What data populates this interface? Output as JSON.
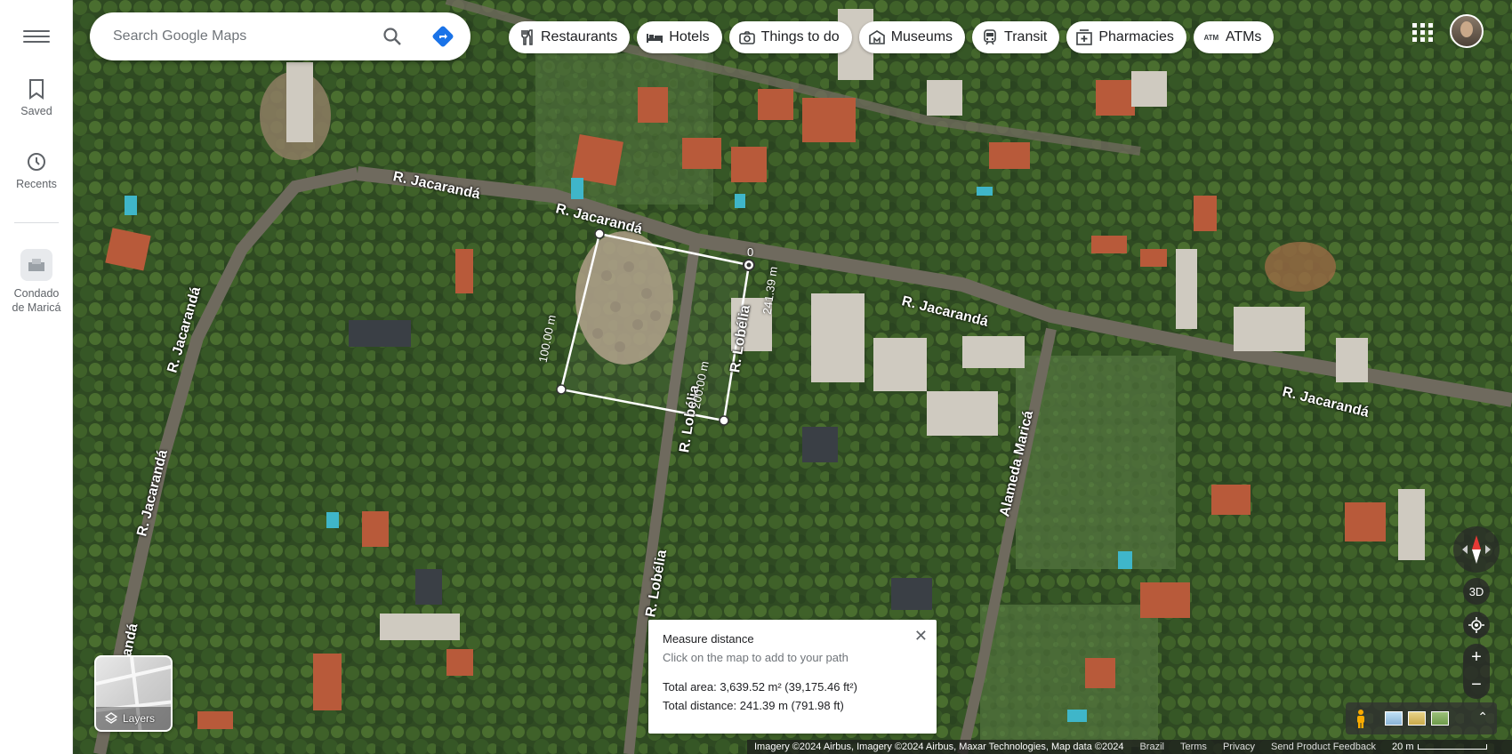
{
  "sidebar": {
    "saved_label": "Saved",
    "recents_label": "Recents",
    "place_line1": "Condado",
    "place_line2": "de Maricá"
  },
  "search": {
    "placeholder": "Search Google Maps"
  },
  "chips": [
    {
      "label": "Restaurants",
      "icon": "fork-knife-icon"
    },
    {
      "label": "Hotels",
      "icon": "bed-icon"
    },
    {
      "label": "Things to do",
      "icon": "camera-icon"
    },
    {
      "label": "Museums",
      "icon": "museum-icon"
    },
    {
      "label": "Transit",
      "icon": "train-icon"
    },
    {
      "label": "Pharmacies",
      "icon": "pharmacy-icon"
    },
    {
      "label": "ATMs",
      "icon": "atm-icon"
    }
  ],
  "map": {
    "streets": {
      "jacaranda_1": "R. Jacarandá",
      "jacaranda_2": "R. Jacarandá",
      "jacaranda_3": "R. Jacarandá",
      "jacaranda_4": "R. Jacarandá",
      "jacaranda_5": "R. Jacarandá",
      "jacaranda_6": "R. Jacarandá",
      "jacaranda_7": "R. Jacarandá",
      "lobelia_1": "R. Lobélia",
      "lobelia_2": "R. Lobélia",
      "lobelia_3": "R. Lobélia",
      "alameda": "Alameda Maricá"
    },
    "measure_labels": {
      "side_left": "100.00 m",
      "side_right": "200.00 m",
      "total_top": "241.39 m",
      "start": "0"
    }
  },
  "measure": {
    "title": "Measure distance",
    "subtitle": "Click on the map to add to your path",
    "area": "Total area: 3,639.52 m² (39,175.46 ft²)",
    "distance": "Total distance: 241.39 m (791.98 ft)"
  },
  "layers": {
    "label": "Layers"
  },
  "controls": {
    "btn3d": "3D",
    "zoom_in": "+",
    "zoom_out": "−"
  },
  "footer": {
    "imagery": "Imagery ©2024 Airbus, Imagery ©2024 Airbus, Maxar Technologies, Map data ©2024",
    "country": "Brazil",
    "terms": "Terms",
    "privacy": "Privacy",
    "feedback": "Send Product Feedback",
    "scale": "20 m"
  },
  "colors": {
    "accent": "#1a73e8",
    "directions": "#1a73e8"
  }
}
